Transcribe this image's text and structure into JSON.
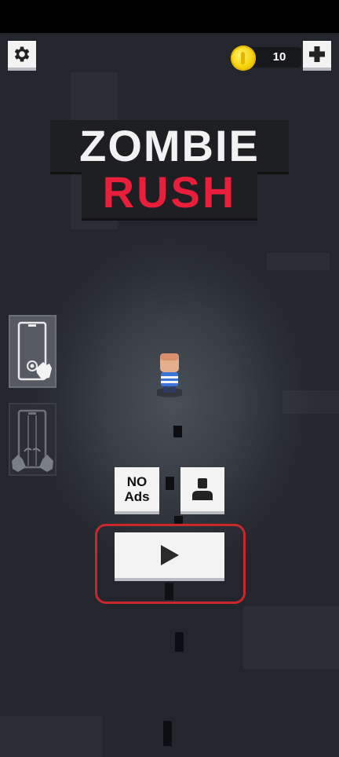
{
  "hud": {
    "coins": "10",
    "settings_icon": "gear-icon",
    "plus_icon": "plus-icon",
    "coin_icon": "coin-icon"
  },
  "logo": {
    "line1": "ZOMBIE",
    "line2": "RUSH"
  },
  "controls": {
    "tap_mode_icon": "phone-tap-icon",
    "swipe_mode_icon": "phone-swipe-icon"
  },
  "menu": {
    "no_ads_label": "NO\nAds",
    "profile_icon": "person-icon",
    "play_icon": "play-icon"
  },
  "colors": {
    "logo_red": "#e81e3a",
    "highlight": "#c8282c",
    "button_bg": "#f3f3f3",
    "coin": "#f6d20c"
  }
}
